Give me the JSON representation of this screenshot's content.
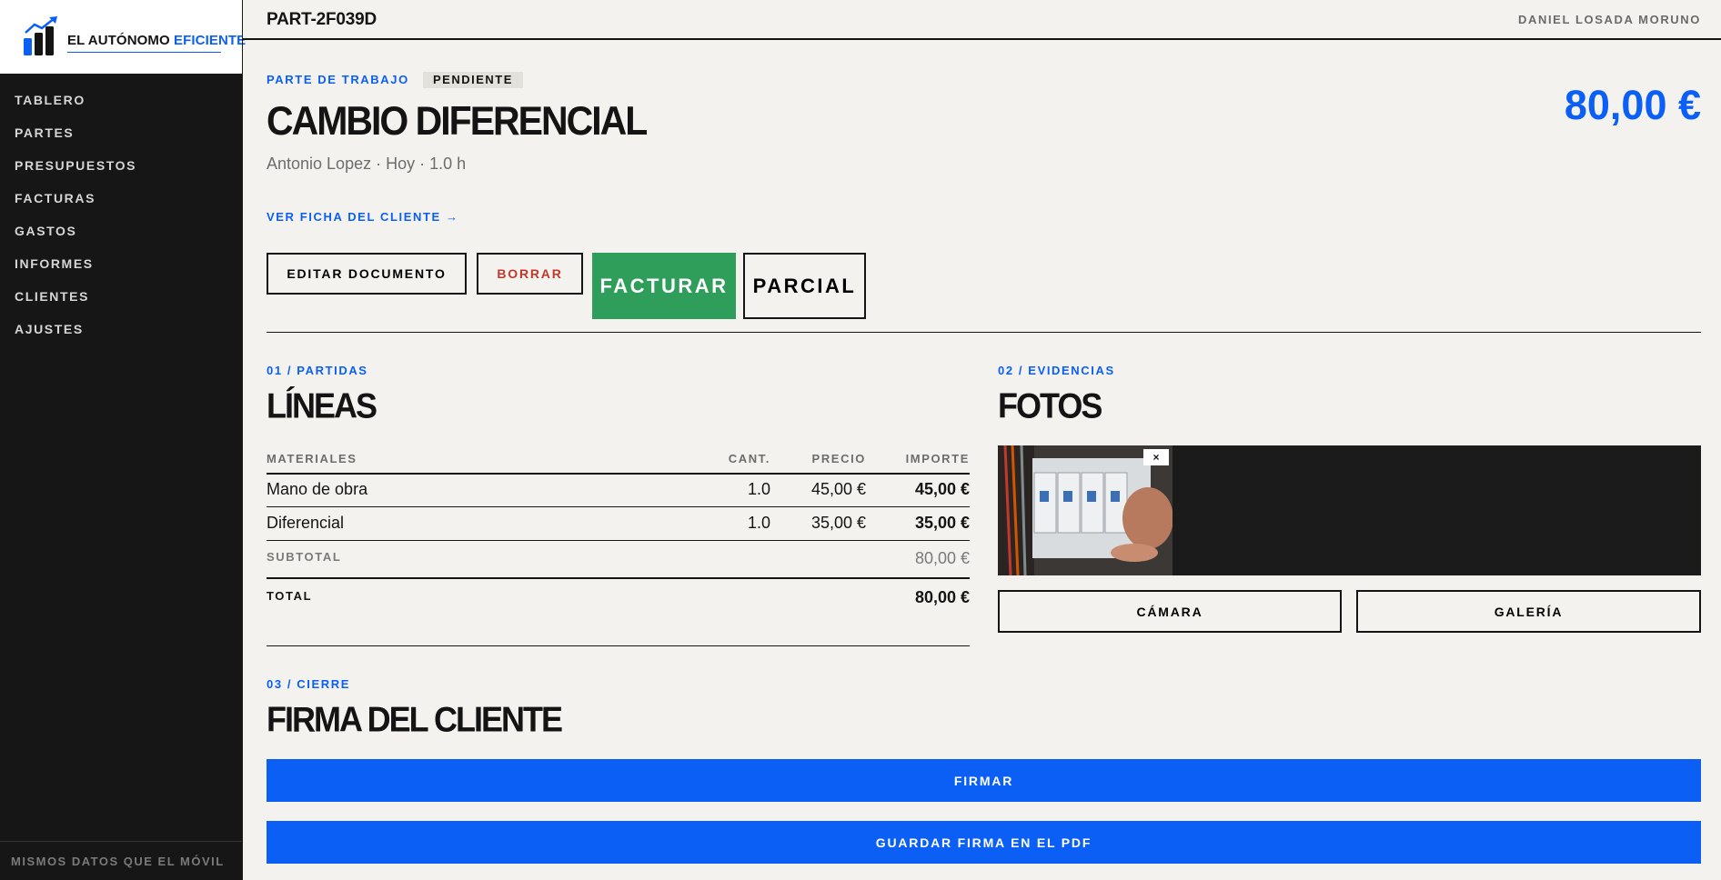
{
  "brand": {
    "name_part1": "EL AUTÓNOMO",
    "name_part2": "EFICIENTE",
    "logo_icon": "bar-chart-trend-icon",
    "accent_color": "#0b5ff5"
  },
  "sidebar": {
    "items": [
      {
        "label": "TABLERO"
      },
      {
        "label": "PARTES"
      },
      {
        "label": "PRESUPUESTOS"
      },
      {
        "label": "FACTURAS"
      },
      {
        "label": "GASTOS"
      },
      {
        "label": "INFORMES"
      },
      {
        "label": "CLIENTES"
      },
      {
        "label": "AJUSTES"
      }
    ],
    "footer": "MISMOS DATOS QUE EL MÓVIL"
  },
  "topbar": {
    "doc_code": "PART-2F039D",
    "user": "DANIEL LOSADA MORUNO"
  },
  "document": {
    "kicker": "PARTE DE TRABAJO",
    "status": "PENDIENTE",
    "title": "CAMBIO DIFERENCIAL",
    "meta": "Antonio Lopez · Hoy · 1.0 h",
    "total": "80,00 €",
    "client_link": "VER FICHA DEL CLIENTE →"
  },
  "actions": {
    "edit": "EDITAR DOCUMENTO",
    "delete": "BORRAR",
    "invoice": "FACTURAR",
    "partial": "PARCIAL",
    "invoice_color": "#2e9e5a",
    "delete_color": "#c0392b"
  },
  "lines": {
    "kicker": "01 / PARTIDAS",
    "title": "LÍNEAS",
    "columns": [
      "MATERIALES",
      "CANT.",
      "PRECIO",
      "IMPORTE"
    ],
    "rows": [
      {
        "name": "Mano de obra",
        "qty": "1.0",
        "price": "45,00 €",
        "amount": "45,00 €"
      },
      {
        "name": "Diferencial",
        "qty": "1.0",
        "price": "35,00 €",
        "amount": "35,00 €"
      }
    ],
    "subtotal_label": "SUBTOTAL",
    "subtotal": "80,00 €",
    "total_label": "TOTAL",
    "total": "80,00 €"
  },
  "photos": {
    "kicker": "02 / EVIDENCIAS",
    "title": "FOTOS",
    "close": "×",
    "camera": "CÁMARA",
    "gallery": "GALERÍA"
  },
  "signature": {
    "kicker": "03 / CIERRE",
    "title": "FIRMA DEL CLIENTE",
    "sign": "FIRMAR",
    "save": "GUARDAR FIRMA EN EL PDF"
  }
}
